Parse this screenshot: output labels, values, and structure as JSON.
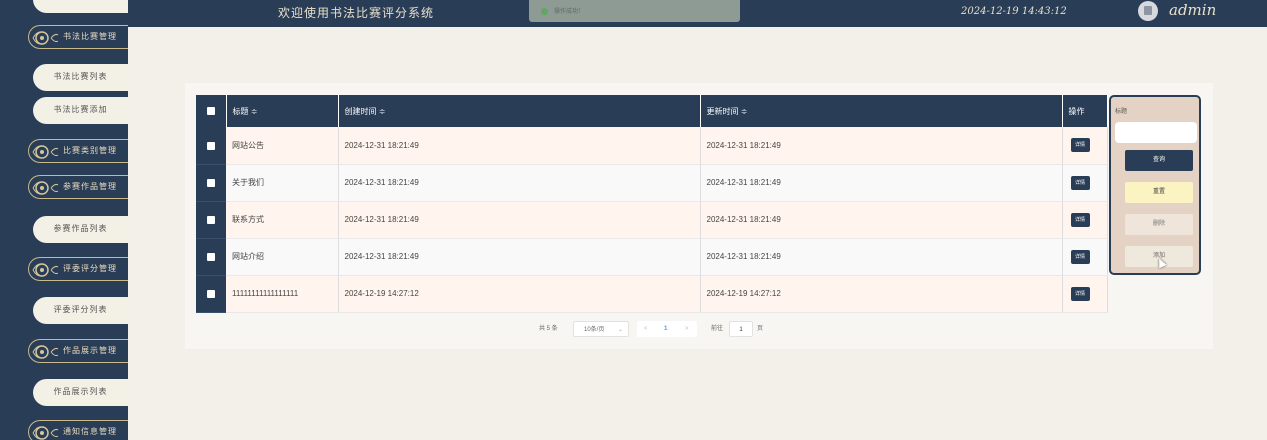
{
  "header": {
    "title": "欢迎使用书法比赛评分系统",
    "datetime": "2024-12-19 14:43:12",
    "username": "admin"
  },
  "toast": {
    "message": "操作成功!"
  },
  "sidebar": {
    "items": [
      {
        "type": "group",
        "label": "书法比赛管理"
      },
      {
        "type": "item",
        "label": "书法比赛列表"
      },
      {
        "type": "item",
        "label": "书法比赛添加"
      },
      {
        "type": "group",
        "label": "比赛类别管理"
      },
      {
        "type": "group",
        "label": "参赛作品管理"
      },
      {
        "type": "item",
        "label": "参赛作品列表"
      },
      {
        "type": "group",
        "label": "评委评分管理"
      },
      {
        "type": "item",
        "label": "评委评分列表"
      },
      {
        "type": "group",
        "label": "作品展示管理"
      },
      {
        "type": "item",
        "label": "作品展示列表"
      },
      {
        "type": "group",
        "label": "通知信息管理"
      }
    ]
  },
  "table": {
    "headers": {
      "title": "标题 ≑",
      "created": "创建时间 ≑",
      "updated": "更新时间 ≑",
      "action": "操作"
    },
    "rows": [
      {
        "title": "网站公告",
        "created": "2024-12-31 18:21:49",
        "updated": "2024-12-31 18:21:49",
        "action": "详情"
      },
      {
        "title": "关于我们",
        "created": "2024-12-31 18:21:49",
        "updated": "2024-12-31 18:21:49",
        "action": "详情"
      },
      {
        "title": "联系方式",
        "created": "2024-12-31 18:21:49",
        "updated": "2024-12-31 18:21:49",
        "action": "详情"
      },
      {
        "title": "网站介绍",
        "created": "2024-12-31 18:21:49",
        "updated": "2024-12-31 18:21:49",
        "action": "详情"
      },
      {
        "title": "11111111111111111",
        "created": "2024-12-19 14:27:12",
        "updated": "2024-12-19 14:27:12",
        "action": "详情"
      }
    ]
  },
  "search": {
    "label": "标题",
    "query": "查询",
    "reset": "重置",
    "delete": "删除",
    "add": "添加"
  },
  "pager": {
    "total": "共 5 条",
    "page_size": "10条/页",
    "page_size_arrow": "⌄",
    "prev": "<",
    "current": "1",
    "next": ">",
    "goto": "前往",
    "goto_value": "1",
    "page_unit": "页"
  },
  "colors": {
    "primary": "#2a3d56",
    "background": "#f3f0e9",
    "accent": "#c9b98b"
  },
  "icons": [
    "ornament-icon",
    "avatar-icon",
    "success-icon",
    "checkbox-icon"
  ]
}
